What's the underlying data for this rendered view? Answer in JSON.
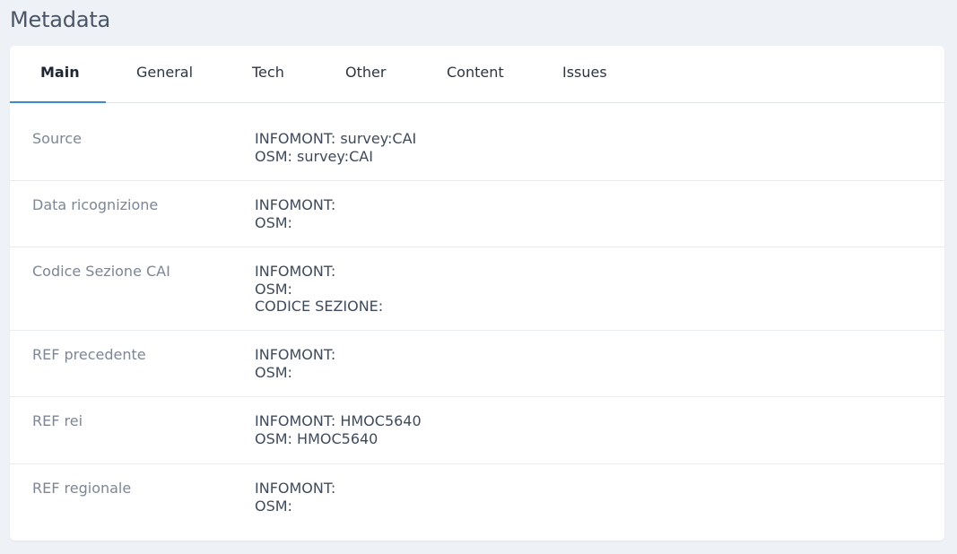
{
  "page": {
    "title": "Metadata"
  },
  "tabs": [
    {
      "label": "Main",
      "active": true
    },
    {
      "label": "General",
      "active": false
    },
    {
      "label": "Tech",
      "active": false
    },
    {
      "label": "Other",
      "active": false
    },
    {
      "label": "Content",
      "active": false
    },
    {
      "label": "Issues",
      "active": false
    }
  ],
  "rows": [
    {
      "label": "Source",
      "values": [
        "INFOMONT: survey:CAI",
        "OSM: survey:CAI"
      ]
    },
    {
      "label": "Data ricognizione",
      "values": [
        "INFOMONT:",
        "OSM:"
      ]
    },
    {
      "label": "Codice Sezione CAI",
      "values": [
        "INFOMONT:",
        "OSM:",
        "CODICE SEZIONE:"
      ]
    },
    {
      "label": "REF precedente",
      "values": [
        "INFOMONT:",
        "OSM:"
      ]
    },
    {
      "label": "REF rei",
      "values": [
        "INFOMONT: HMOC5640",
        "OSM: HMOC5640"
      ]
    },
    {
      "label": "REF regionale",
      "values": [
        "INFOMONT:",
        "OSM:"
      ]
    }
  ],
  "colors": {
    "background": "#eef1f5",
    "card": "#ffffff",
    "accent": "#3a8bc8",
    "label": "#7d8694",
    "text": "#3f4a5a"
  }
}
